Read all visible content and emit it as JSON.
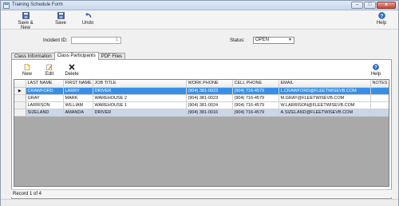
{
  "window": {
    "title": "Training Schedule Form",
    "minimize": "–",
    "maximize": "□",
    "close": "x"
  },
  "toolbar": {
    "save_new": "Save & New",
    "save": "Save",
    "undo": "Undo",
    "help": "Help"
  },
  "form": {
    "incident_label": "Incident ID:",
    "incident_value": "1",
    "status_label": "Status:",
    "status_value": "OPEN"
  },
  "tabs": [
    "Class Information",
    "Class Participants",
    "PDF Files"
  ],
  "panel_toolbar": {
    "new": "New",
    "edit": "Edit",
    "delete": "Delete",
    "help": "Help"
  },
  "grid": {
    "columns": [
      "LAST NAME",
      "FIRST NAME",
      "JOB TITLE",
      "WORK PHONE",
      "CELL PHONE",
      "EMAIL",
      "NOTES"
    ],
    "row_indicator": "▶",
    "rows": [
      [
        "CRAWFORD",
        "LARRY",
        "DRIVER",
        "(904) 381-0023",
        "(904) 716-4579",
        "L.CRAWFORD@FLEETWISEVB.COM",
        ""
      ],
      [
        "GRAY",
        "MARK",
        "WAREHOUSE 2",
        "(904) 381-0023",
        "(904) 716-4579",
        "M.GRAY@FLEETWISEVB.COM",
        ""
      ],
      [
        "LARRISON",
        "WILLIAM",
        "WAREHOUSE 1",
        "(904) 381-0024",
        "(904) 716-4579",
        "W.LARRISON@FLEETWISEVB.COM",
        ""
      ],
      [
        "SIZELAND",
        "AMANDA",
        "DRIVER",
        "(904) 381-0016",
        "(904) 716-4579",
        "A.SIZELAND@FLEETWISEVB.COM",
        ""
      ]
    ]
  },
  "record_status": "Record 1 of 4",
  "colors": {
    "selected_row": "#3d8ee0",
    "highlight_row": "#c9d7ea",
    "close_button": "#c8463a"
  }
}
